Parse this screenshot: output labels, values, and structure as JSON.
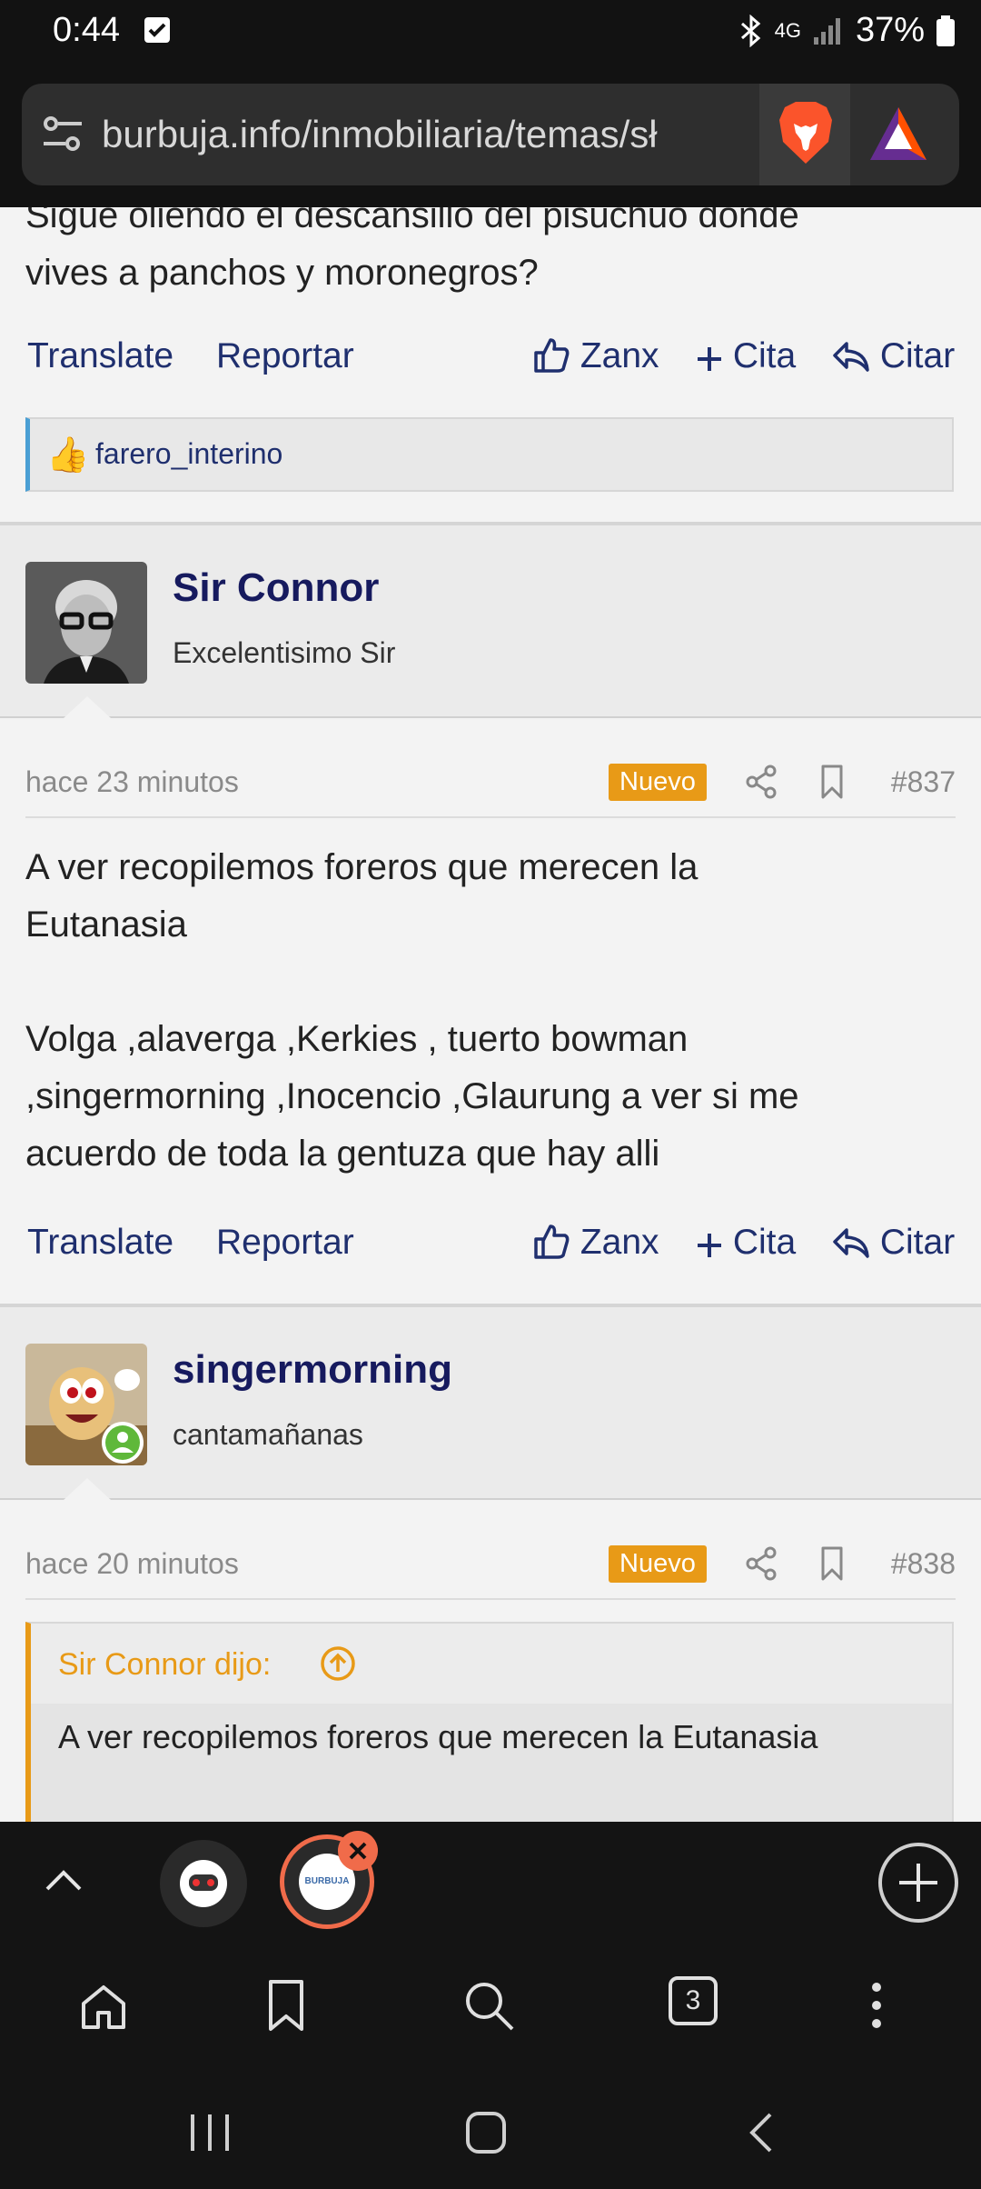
{
  "status_bar": {
    "time": "0:44",
    "network": "4G",
    "battery": "37%",
    "icons": [
      "note-icon",
      "bluetooth-icon",
      "signal-icon",
      "battery-icon"
    ]
  },
  "browser": {
    "url": "burbuja.info/inmobiliaria/temas/sh",
    "url_visible": "burbuja.info/inmobiliaria/temas/sł"
  },
  "posts": [
    {
      "body_lines": [
        "Sigue oliendo el descansillo del pisuchuo donde",
        "vives a panchos y moronegros?"
      ],
      "actions": {
        "translate": "Translate",
        "report": "Reportar",
        "like": "Zanx",
        "multiquote": "Cita",
        "reply": "Citar"
      },
      "reaction_user": "farero_interino"
    },
    {
      "username": "Sir Connor",
      "user_title": "Excelentisimo Sir",
      "time": "hace 23 minutos",
      "badge": "Nuevo",
      "number": "#837",
      "body_lines": [
        "A ver recopilemos foreros que merecen la",
        "Eutanasia",
        "",
        "Volga ,alaverga ,Kerkies , tuerto bowman",
        ",singermorning ,Inocencio ,Glaurung a ver si me",
        "acuerdo de toda la gentuza que hay alli"
      ],
      "actions": {
        "translate": "Translate",
        "report": "Reportar",
        "like": "Zanx",
        "multiquote": "Cita",
        "reply": "Citar"
      }
    },
    {
      "username": "singermorning",
      "user_title": "cantamañanas",
      "time": "hace 20 minutos",
      "badge": "Nuevo",
      "number": "#838",
      "quote_header": "Sir Connor dijo:",
      "quote_text": "A ver recopilemos foreros que merecen la Eutanasia"
    }
  ],
  "tabs": {
    "count": "3",
    "tab2_label": "BURBUJA"
  },
  "colors": {
    "accent_link": "#1f2f6e",
    "badge": "#e89a17",
    "reaction_border": "#4a9fd4",
    "active_tab_ring": "#f06b4a"
  }
}
